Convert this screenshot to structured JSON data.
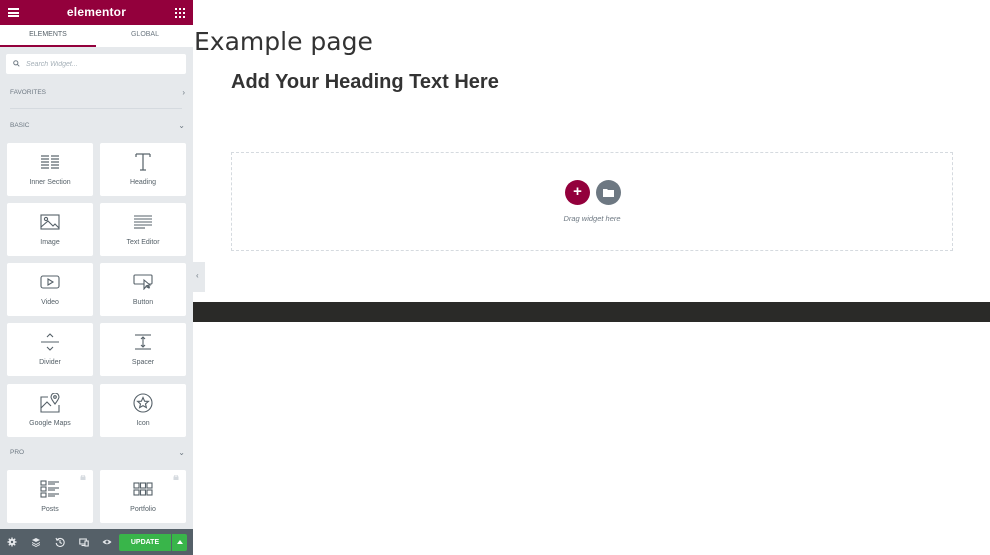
{
  "panel": {
    "brand": "elementor",
    "tabs": [
      "ELEMENTS",
      "GLOBAL"
    ],
    "search_placeholder": "Search Widget...",
    "categories": {
      "favorites": "FAVORITES",
      "basic": "BASIC",
      "pro": "PRO"
    },
    "widgets": [
      {
        "label": "Inner Section",
        "icon": "inner-section-icon"
      },
      {
        "label": "Heading",
        "icon": "heading-icon"
      },
      {
        "label": "Image",
        "icon": "image-icon"
      },
      {
        "label": "Text Editor",
        "icon": "text-editor-icon"
      },
      {
        "label": "Video",
        "icon": "video-icon"
      },
      {
        "label": "Button",
        "icon": "button-icon"
      },
      {
        "label": "Divider",
        "icon": "divider-icon"
      },
      {
        "label": "Spacer",
        "icon": "spacer-icon"
      },
      {
        "label": "Google Maps",
        "icon": "google-maps-icon"
      },
      {
        "label": "Icon",
        "icon": "star-icon"
      }
    ],
    "pro_widgets": [
      {
        "label": "Posts",
        "icon": "posts-icon"
      },
      {
        "label": "Portfolio",
        "icon": "portfolio-icon"
      }
    ],
    "footer": {
      "update_label": "UPDATE"
    }
  },
  "canvas": {
    "page_title": "Example page",
    "heading": "Add Your Heading Text Here",
    "drop_text": "Drag widget here"
  },
  "colors": {
    "brand": "#93003c",
    "update": "#39b54a",
    "footer": "#556068",
    "panel_bg": "#e6e9ec"
  }
}
